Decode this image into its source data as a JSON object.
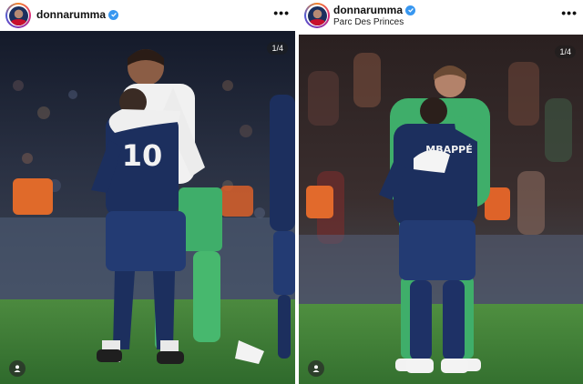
{
  "left_post": {
    "username": "donnarumma",
    "more_label": "•••",
    "carousel_counter": "1/4",
    "icons": {
      "verified": "verified-badge-icon",
      "more": "more-options-icon",
      "tag": "user-tag-icon"
    },
    "jersey_number": "10"
  },
  "right_post": {
    "username": "donnarumma",
    "location": "Parc Des Princes",
    "more_label": "•••",
    "carousel_counter": "1/4",
    "icons": {
      "verified": "verified-badge-icon",
      "more": "more-options-icon",
      "tag": "user-tag-icon"
    },
    "jersey_name": "MBAPPÉ"
  },
  "colors": {
    "verified_blue": "#3897f0",
    "psg_navy": "#1c2f5e",
    "keeper_green": "#3fae6a",
    "pitch_green": "#3f7d3a"
  }
}
